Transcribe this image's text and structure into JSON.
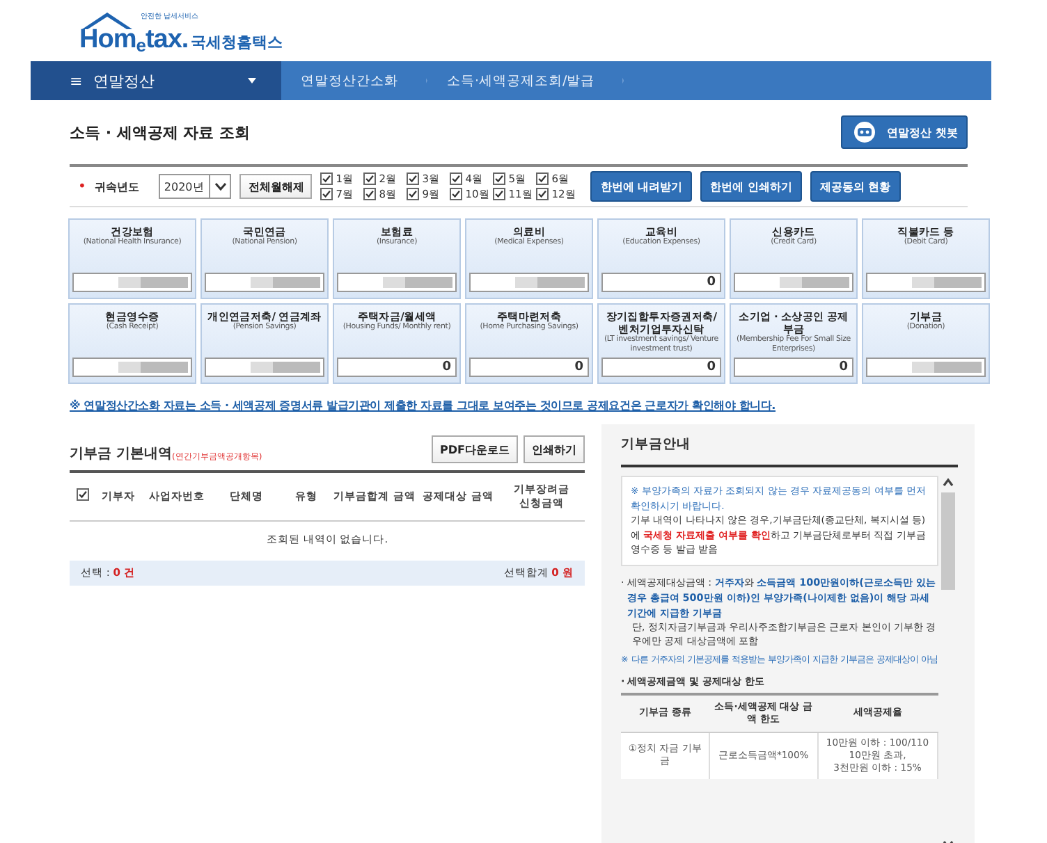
{
  "logo": {
    "tagline": "안전한 납세서비스",
    "brand_a": "Hom",
    "brand_e": "e",
    "brand_b": "tax.",
    "brand_ko": "국세청홈택스"
  },
  "nav": {
    "menu_icon": "≡",
    "menu": "연말정산",
    "crumbs": [
      "연말정산간소화",
      "소득·세액공제조회/발급"
    ]
  },
  "page_title": "소득 · 세액공제 자료 조회",
  "chatbot_button": "연말정산 챗봇",
  "filter": {
    "required_mark": "•",
    "year_label": "귀속년도",
    "year_value": "2020년",
    "toggle_all_button": "전체월해제",
    "months": [
      {
        "label": "1월",
        "checked": true
      },
      {
        "label": "2월",
        "checked": true
      },
      {
        "label": "3월",
        "checked": true
      },
      {
        "label": "4월",
        "checked": true
      },
      {
        "label": "5월",
        "checked": true
      },
      {
        "label": "6월",
        "checked": true
      },
      {
        "label": "7월",
        "checked": true
      },
      {
        "label": "8월",
        "checked": true
      },
      {
        "label": "9월",
        "checked": true
      },
      {
        "label": "10월",
        "checked": true
      },
      {
        "label": "11월",
        "checked": true
      },
      {
        "label": "12월",
        "checked": true
      }
    ],
    "actions": [
      "한번에 내려받기",
      "한번에 인쇄하기",
      "제공동의 현황"
    ]
  },
  "cards": [
    {
      "title": "건강보험",
      "subtitle": "(National Health Insurance)",
      "masked": true
    },
    {
      "title": "국민연금",
      "subtitle": "(National Pension)",
      "masked": true
    },
    {
      "title": "보험료",
      "subtitle": "(Insurance)",
      "masked": true
    },
    {
      "title": "의료비",
      "subtitle": "(Medical Expenses)",
      "masked": true
    },
    {
      "title": "교육비",
      "subtitle": "(Education Expenses)",
      "masked": false,
      "value": "0"
    },
    {
      "title": "신용카드",
      "subtitle": "(Credit Card)",
      "masked": true
    },
    {
      "title": "직불카드 등",
      "subtitle": "(Debit Card)",
      "masked": true
    },
    {
      "title": "현금영수증",
      "subtitle": "(Cash Receipt)",
      "masked": true
    },
    {
      "title": "개인연금저축/ 연금계좌",
      "subtitle": "(Pension Savings)",
      "masked": true
    },
    {
      "title": "주택자금/월세액",
      "subtitle": "(Housing Funds/ Monthly rent)",
      "masked": false,
      "value": "0"
    },
    {
      "title": "주택마련저축",
      "subtitle": "(Home Purchasing Savings)",
      "masked": false,
      "value": "0"
    },
    {
      "title": "장기집합투자증권저축/ 벤처기업투자신탁",
      "subtitle": "(LT investment savings/ Venture investment trust)",
      "masked": false,
      "value": "0"
    },
    {
      "title": "소기업 · 소상공인 공제부금",
      "subtitle": "(Membership Fee For Small Size Enterprises)",
      "masked": false,
      "value": "0"
    },
    {
      "title": "기부금",
      "subtitle": "(Donation)",
      "masked": true
    }
  ],
  "notice": "※ 연말정산간소화 자료는 소득 · 세액공제 증명서류 발급기관이 제출한 자료를 그대로 보여주는 것이므로 공제요건은 근로자가 확인해야 합니다.",
  "donation": {
    "title": "기부금 기본내역",
    "title_note": "(연간기부금액공개항목)",
    "buttons": [
      "PDF다운로드",
      "인쇄하기"
    ],
    "select_all_checked": true,
    "columns": [
      "기부자",
      "사업자번호",
      "단체명",
      "유형",
      "기부금합계 금액",
      "공제대상 금액",
      "기부장려금 신청금액"
    ],
    "empty_message": "조회된 내역이 없습니다.",
    "footer": {
      "selected_label": "선택 : ",
      "selected_count": "0 건",
      "total_label": "선택합계 ",
      "total_value": "0 원"
    }
  },
  "guide": {
    "title": "기부금안내",
    "box_note": "※ 부양가족의 자료가 조회되지 않는 경우 자료제공동의 여부를 먼저 확인하시기 바랍니다.",
    "box_text": "기부 내역이 나타나지 않은 경우,기부금단체(종교단체, 복지시설 등)에 **국세청 자료제출 여부를 확인**하고 기부금단체로부터 직접 기부금영수증 등 발급 받음",
    "bullet_mark": "·",
    "bullet_1": "세액공제대상금액 : **거주자**와 **소득금액 100만원이하(근로소득만 있는 경우 총급여 500만원 이하)인 부양가족(나이제한 없음)이 해당 과세기간에 지급한 기부금**",
    "bullet_1_detail": "단, 정치자금기부금과 우리사주조합기부금은 근로자 본인이 기부한 경우에만 공제 대상금액에 포함",
    "note_2": "※ 다른 거주자의 기본공제를 적용받는 부양가족이 지급한 기부금은 공제대상이 아님",
    "bullet_2": "세액공제금액 및 공제대상 한도",
    "table_columns": [
      "기부금 종류",
      "소득·세액공제 대상 금액 한도",
      "세액공제율"
    ],
    "table_rows": [
      {
        "type": "①정치 자금 기부금",
        "limit": "근로소득금액*100%",
        "rates": [
          "10만원 이하 : 100/110",
          "10만원 초과,",
          "3천만원 이하 : 15%"
        ]
      }
    ]
  }
}
